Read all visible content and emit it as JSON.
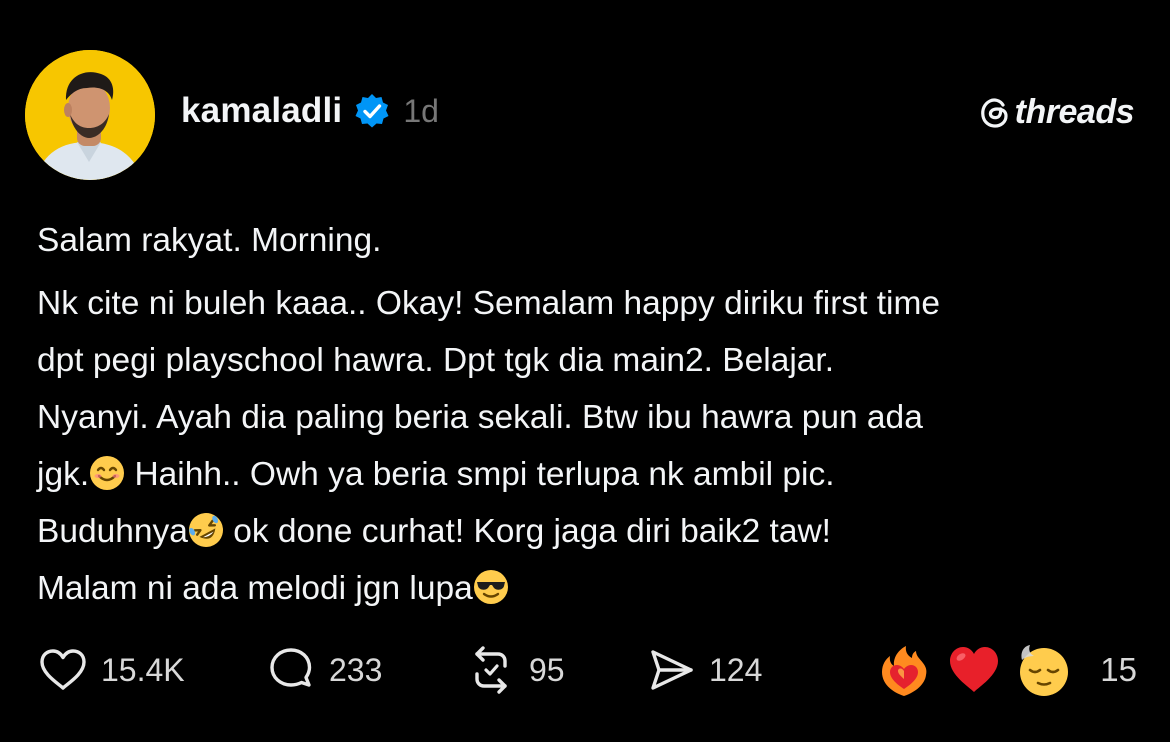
{
  "author": {
    "username": "kamaladli",
    "verified": true,
    "time": "1d",
    "avatar_bg": "#f7c600"
  },
  "brand": {
    "icon": "threads-icon",
    "name": "threads"
  },
  "post": {
    "line1": "Salam rakyat. Morning.",
    "lines": {
      "l1": "Nk cite ni buleh kaaa.. Okay! Semalam happy diriku first time",
      "l2": "dpt pegi playschool hawra. Dpt tgk dia main2. Belajar.",
      "l3": "Nyanyi. Ayah dia paling beria sekali. Btw ibu hawra pun ada",
      "l4a": "jgk.",
      "l4b": " Haihh.. Owh ya beria smpi terlupa nk ambil pic.",
      "l5a": "Buduhnya",
      "l5b": " ok done curhat! Korg jaga diri baik2 taw!",
      "l6": "Malam ni ada melodi jgn lupa"
    },
    "emojis": [
      "smiling-face-icon",
      "rolling-laughing-icon",
      "sunglasses-face-icon"
    ]
  },
  "actions": {
    "likes": "15.4K",
    "comments": "233",
    "reposts": "95",
    "shares": "124"
  },
  "reactions": {
    "icons": [
      "heart-on-fire-icon",
      "red-heart-icon",
      "relieved-face-icon"
    ],
    "count": "15"
  },
  "colors": {
    "background": "#000000",
    "text": "#f3f5f7",
    "muted": "#777777",
    "verified_blue": "#0095f6"
  }
}
